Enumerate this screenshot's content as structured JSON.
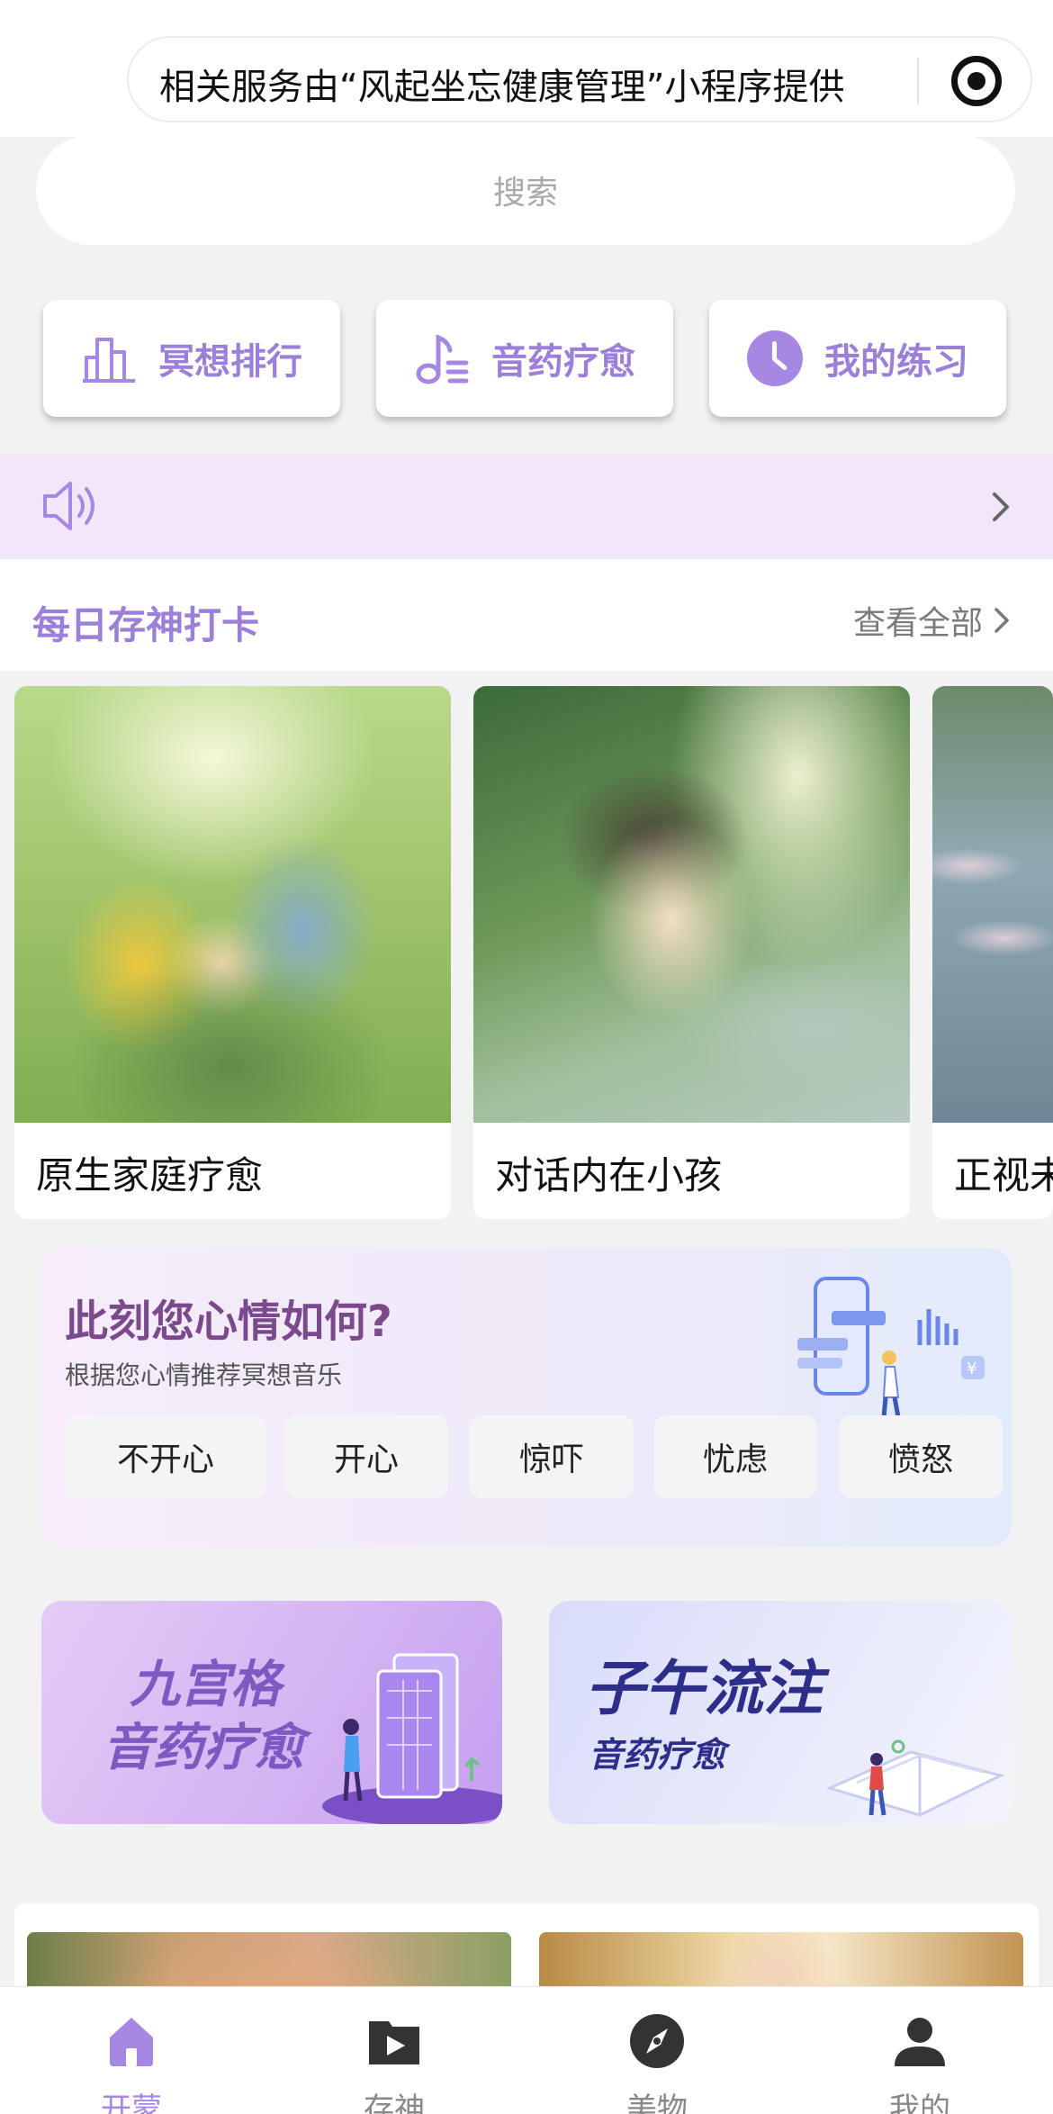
{
  "topbar": {
    "service_text": "相关服务由“风起坐忘健康管理”小程序提供"
  },
  "search": {
    "placeholder": "搜索"
  },
  "quick_actions": [
    {
      "label": "冥想排行",
      "icon": "bar-chart-icon"
    },
    {
      "label": "音药疗愈",
      "icon": "music-note-icon"
    },
    {
      "label": "我的练习",
      "icon": "clock-icon"
    }
  ],
  "notice": {
    "icon": "speaker-icon",
    "text": ""
  },
  "checkin": {
    "title": "每日存神打卡",
    "view_all": "查看全部",
    "cards": [
      {
        "title": "原生家庭疗愈"
      },
      {
        "title": "对话内在小孩"
      },
      {
        "title": "正视未"
      }
    ]
  },
  "mood": {
    "title": "此刻您心情如何?",
    "subtitle": "根据您心情推荐冥想音乐",
    "options": [
      "不开心",
      "开心",
      "惊吓",
      "忧虑",
      "愤怒"
    ]
  },
  "promos": [
    {
      "line1": "九宫格",
      "line2": "音药疗愈"
    },
    {
      "line1": "子午流注",
      "line2": "音药疗愈"
    }
  ],
  "tabbar": {
    "items": [
      {
        "label": "开蒙",
        "icon": "home-icon",
        "active": true
      },
      {
        "label": "存神",
        "icon": "play-icon",
        "active": false
      },
      {
        "label": "美物",
        "icon": "compass-icon",
        "active": false
      },
      {
        "label": "我的",
        "icon": "user-icon",
        "active": false
      }
    ]
  },
  "colors": {
    "accent": "#9b7fd8",
    "notice_bg": "#f2e6fb",
    "mood_title": "#7a4a8c",
    "promo_text_blue": "#2d2e8a"
  }
}
